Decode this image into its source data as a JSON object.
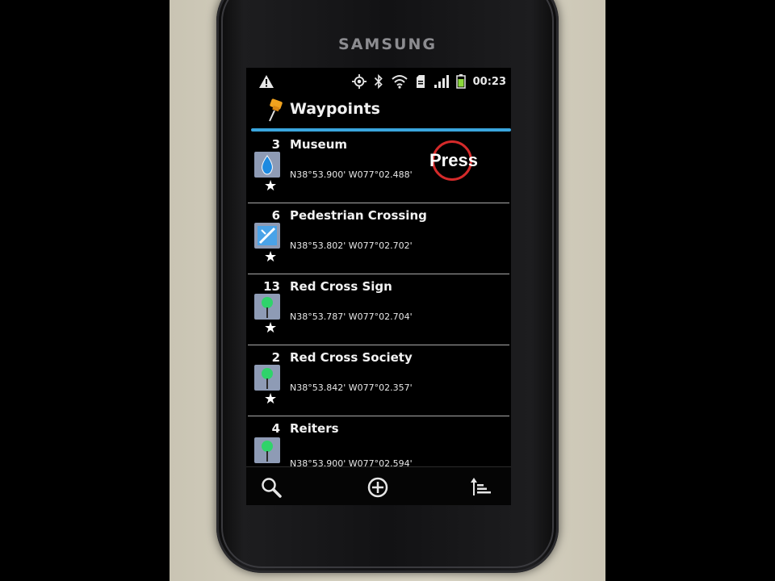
{
  "device": {
    "brand": "SAMSUNG"
  },
  "status_bar": {
    "time": "00:23",
    "icons": [
      "warning-icon",
      "gps-icon",
      "bluetooth-icon",
      "wifi-icon",
      "sd-card-icon",
      "signal-icon",
      "battery-icon"
    ]
  },
  "app": {
    "title": "Waypoints",
    "title_icon": "pushpin-icon"
  },
  "waypoints": [
    {
      "number": "3",
      "name": "Museum",
      "coords": "N38°53.900' W077°02.488'",
      "icon": "water-drop-icon",
      "starred": true
    },
    {
      "number": "6",
      "name": "Pedestrian Crossing",
      "coords": "N38°53.802' W077°02.702'",
      "icon": "crossing-icon",
      "starred": true
    },
    {
      "number": "13",
      "name": "Red Cross Sign",
      "coords": "N38°53.787' W077°02.704'",
      "icon": "green-pin-icon",
      "starred": true
    },
    {
      "number": "2",
      "name": "Red Cross Society",
      "coords": "N38°53.842' W077°02.357'",
      "icon": "green-pin-icon",
      "starred": true
    },
    {
      "number": "4",
      "name": "Reiters",
      "coords": "N38°53.900' W077°02.594'",
      "icon": "green-pin-icon",
      "starred": false
    }
  ],
  "bottom_bar": {
    "search": "search-icon",
    "add": "add-icon",
    "sort": "sort-icon"
  },
  "annotation": {
    "label": "Press",
    "color": "#d52a2a"
  },
  "colors": {
    "accent": "#3aa6de",
    "icon_bg": "#8e9bb5",
    "pin_green": "#2fd36a",
    "drop_blue": "#1e8ae0"
  }
}
